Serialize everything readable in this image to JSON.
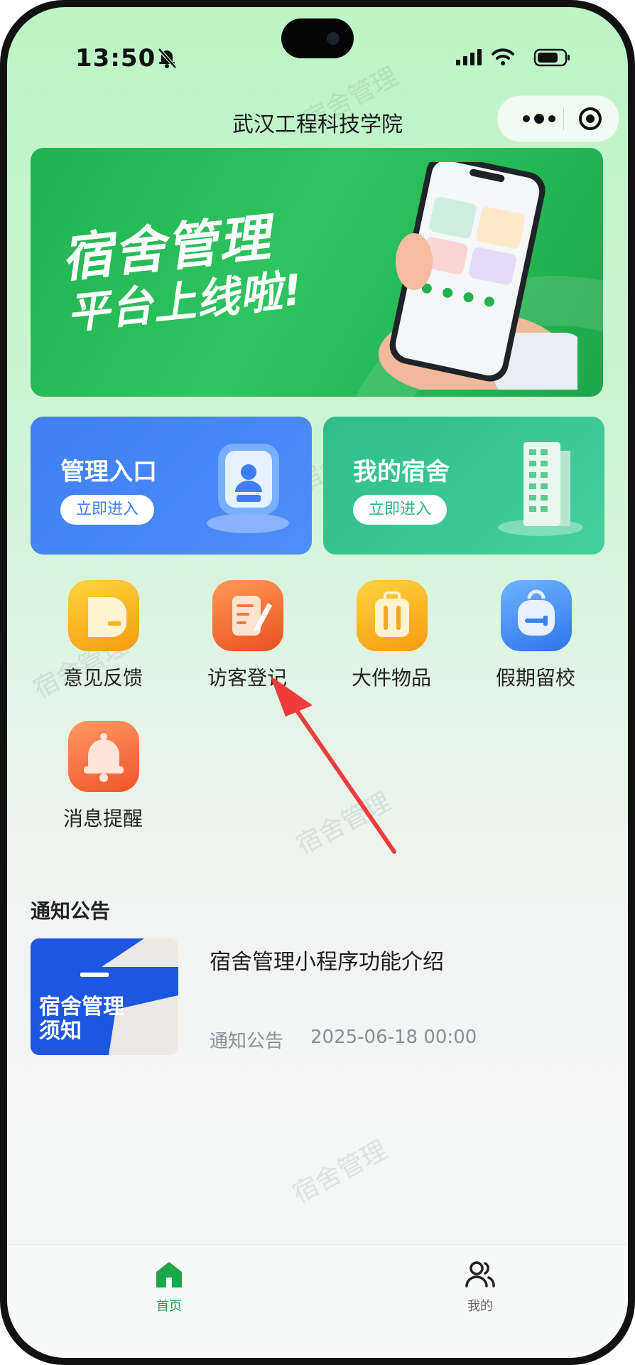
{
  "status_bar": {
    "time": "13:50"
  },
  "nav": {
    "title": "武汉工程科技学院"
  },
  "banner": {
    "line1": "宿舍管理",
    "line2": "平台上线啦!"
  },
  "entries": [
    {
      "title": "管理入口",
      "button": "立即进入"
    },
    {
      "title": "我的宿舍",
      "button": "立即进入"
    }
  ],
  "features": [
    {
      "label": "意见反馈",
      "icon": "feedback-icon",
      "color": "#f7b21a"
    },
    {
      "label": "访客登记",
      "icon": "visitor-register-icon",
      "color": "#f26a2e"
    },
    {
      "label": "大件物品",
      "icon": "suitcase-icon",
      "color": "#f8a714"
    },
    {
      "label": "假期留校",
      "icon": "backpack-icon",
      "color": "#3c82f0"
    },
    {
      "label": "消息提醒",
      "icon": "bell-icon",
      "color": "#f46d3a"
    }
  ],
  "notice": {
    "section_title": "通知公告",
    "items": [
      {
        "title": "宿舍管理小程序功能介绍",
        "category": "通知公告",
        "date": "2025-06-18 00:00",
        "thumb_text": "宿舍管理须知"
      }
    ]
  },
  "tabbar": [
    {
      "label": "首页",
      "icon": "home-icon",
      "active": true
    },
    {
      "label": "我的",
      "icon": "user-group-icon",
      "active": false
    }
  ],
  "watermark": "宿舍管理",
  "colors": {
    "active_tab": "#1ea64a",
    "inactive_tab": "#666666"
  }
}
